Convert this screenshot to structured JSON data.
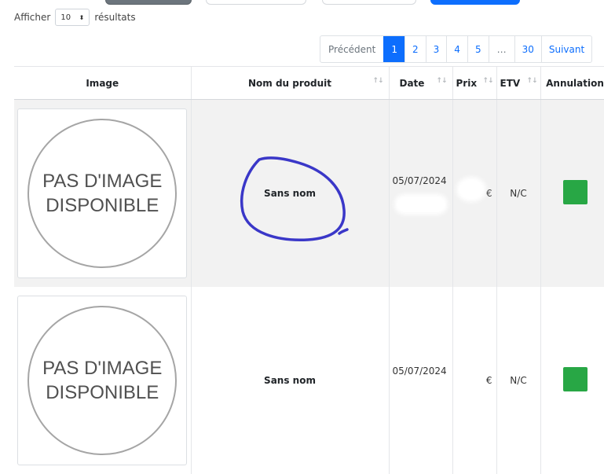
{
  "length_menu": {
    "prefix": "Afficher",
    "value": "10",
    "suffix": "résultats"
  },
  "pagination": {
    "previous": "Précédent",
    "pages": [
      "1",
      "2",
      "3",
      "4",
      "5",
      "…",
      "30"
    ],
    "active_page": "1",
    "next": "Suivant"
  },
  "table": {
    "columns": [
      "Image",
      "Nom du produit",
      "Date",
      "Prix",
      "ETV",
      "Annulation"
    ],
    "rows": [
      {
        "image_text_line1": "PAS D'IMAGE",
        "image_text_line2": "DISPONIBLE",
        "name": "Sans nom",
        "date": "05/07/2024",
        "price_currency": "€",
        "etv": "N/C",
        "annulation_color": "#28a745"
      },
      {
        "image_text_line1": "PAS D'IMAGE",
        "image_text_line2": "DISPONIBLE",
        "name": "Sans nom",
        "date": "05/07/2024",
        "price_currency": "€",
        "etv": "N/C",
        "annulation_color": "#28a745"
      }
    ]
  },
  "colors": {
    "accent": "#0d6efd",
    "annotation_ink": "#3a37c8",
    "status_green": "#28a745"
  },
  "icons": {
    "sort": "sort-arrows-icon",
    "select_caret": "select-caret-icon"
  }
}
